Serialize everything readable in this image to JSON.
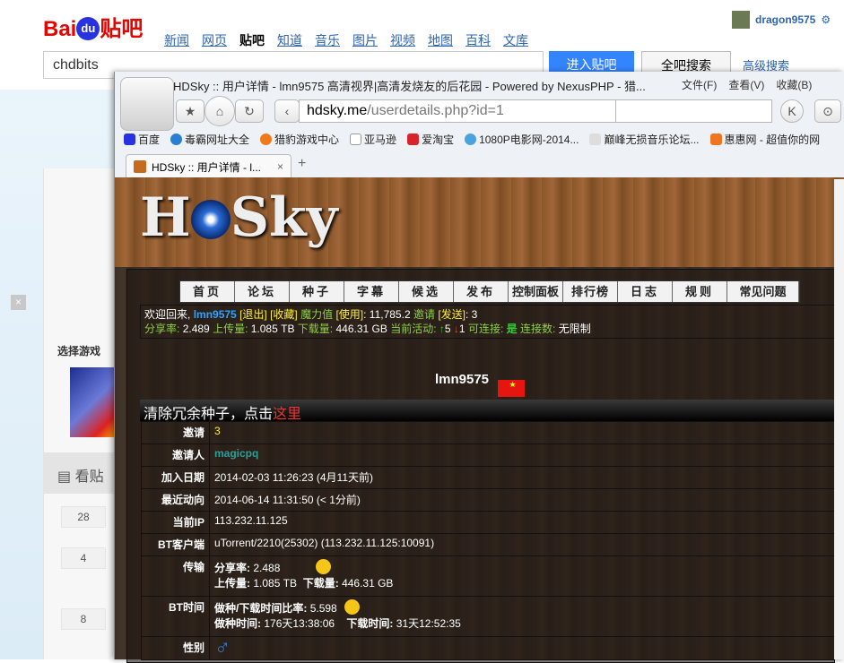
{
  "baidu": {
    "logo": "Bai du 贴吧",
    "nav": [
      "新闻",
      "网页",
      "贴吧",
      "知道",
      "音乐",
      "图片",
      "视频",
      "地图",
      "百科",
      "文库"
    ],
    "search_value": "chdbits",
    "enter_btn": "进入贴吧",
    "all_btn": "全吧搜索",
    "advanced": "高级搜索",
    "user": "dragon9575",
    "select_game": "选择游戏",
    "kantie": "看贴",
    "counts": [
      "28",
      "4",
      "8"
    ],
    "close": "×"
  },
  "browser": {
    "title": "HDSky :: 用户详情 - lmn9575 高清视界|高清发烧友的后花园 - Powered by NexusPHP - 猎...",
    "menu": [
      "文件(F)",
      "查看(V)",
      "收藏(B)"
    ],
    "url_host": "hdsky.me",
    "url_path": "/userdetails.php?id=1",
    "bookmarks": [
      "百度",
      "毒霸网址大全",
      "猎豹游戏中心",
      "亚马逊",
      "爱淘宝",
      "1080P电影网-2014...",
      "巅峰无损音乐论坛...",
      "惠惠网 - 超值你的网"
    ],
    "tab_title": "HDSky :: 用户详情 - l...",
    "new_tab": "+"
  },
  "site": {
    "logo": "HDSky",
    "nav": [
      "首页",
      "论坛",
      "种子",
      "字幕",
      "候选",
      "发布",
      "控制面板",
      "排行榜",
      "日志",
      "规则",
      "常见问题"
    ],
    "welcome": "欢迎回来,",
    "username": "lmn9575",
    "logout": "[退出]",
    "favorites": "[收藏]",
    "bonus_label": "魔力值",
    "use": "[使用]",
    "bonus": ": 11,785.2",
    "invite_label": "邀请",
    "send": "[发送]",
    "invites": ": 3",
    "ratio_label": "分享率:",
    "ratio": "2.489",
    "up_label": "上传量:",
    "up": "1.085 TB",
    "down_label": "下载量:",
    "down": "446.31 GB",
    "active_label": "当前活动:",
    "seeding": "5",
    "leeching": "1",
    "connectable_label": "可连接:",
    "connectable": "是",
    "conn_label": "连接数:",
    "conn": "无限制",
    "profile_name": "lmn9575",
    "banner": "清除冗余种子，点击",
    "banner_link": "这里",
    "rows": {
      "invite": {
        "label": "邀请",
        "value": "3"
      },
      "inviter": {
        "label": "邀请人",
        "value": "magicpq"
      },
      "joined": {
        "label": "加入日期",
        "value": "2014-02-03 11:26:23 (4月11天前)"
      },
      "last": {
        "label": "最近动向",
        "value": "2014-06-14 11:31:50 (< 1分前)"
      },
      "ip": {
        "label": "当前IP",
        "value": "113.232.11.125"
      },
      "client": {
        "label": "BT客户端",
        "value": "uTorrent/2210(25302) (113.232.11.125:10091)"
      },
      "transfer": {
        "label": "传输",
        "ratio_label": "分享率:",
        "ratio": "2.488",
        "up_label": "上传量:",
        "up": "1.085 TB",
        "down_label": "下载量:",
        "down": "446.31 GB"
      },
      "bttime": {
        "label": "BT时间",
        "ratio_label": "做种/下载时间比率:",
        "ratio": "5.598",
        "seed_label": "做种时间:",
        "seed": "176天13:38:06",
        "dl_label": "下载时间:",
        "dl": "31天12:52:35"
      },
      "gender": {
        "label": "性别",
        "value": "♂"
      }
    }
  }
}
